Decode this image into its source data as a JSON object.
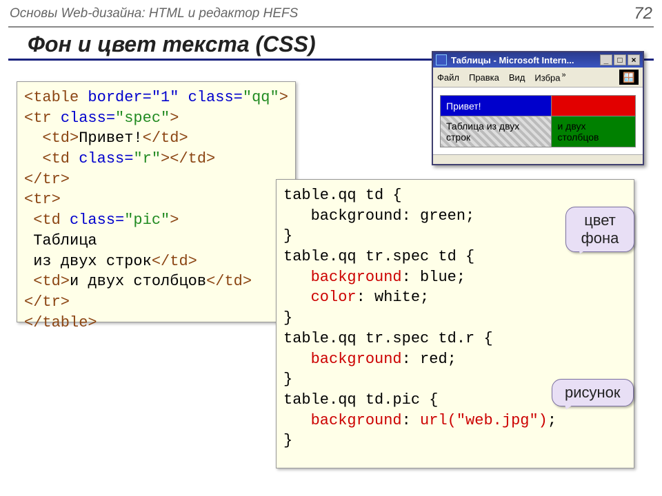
{
  "header": {
    "breadcrumb": "Основы Web-дизайна: HTML и редактор HEFS",
    "page": "72"
  },
  "title": "Фон и цвет текста (CSS)",
  "html_code": {
    "l1a": "<table ",
    "l1b": "border=\"1\"",
    "l1c": " class=",
    "l1d": "\"qq\"",
    "l1e": ">",
    "l2a": "<tr ",
    "l2b": "class=",
    "l2c": "\"spec\"",
    "l2d": ">",
    "l3a": "  <td>",
    "l3b": "Привет!",
    "l3c": "</td>",
    "l4a": "  <td ",
    "l4b": "class=",
    "l4c": "\"r\"",
    "l4d": "></td>",
    "l5": "</tr>",
    "l6": "<tr>",
    "l7a": " <td ",
    "l7b": "class=",
    "l7c": "\"pic\"",
    "l7d": ">",
    "l8": " Таблица",
    "l9a": " из двух строк",
    "l9b": "</td>",
    "l10a": " <td>",
    "l10b": "и двух столбцов",
    "l10c": "</td>",
    "l11": "</tr>",
    "l12": "</table>"
  },
  "css_code": {
    "l1": "table.qq td {",
    "l2a": "   background",
    "l2b": ": green;",
    "l3": "}",
    "l4": "table.qq tr.spec td {",
    "l5a": "   background",
    "l5b": ": blue;",
    "l6a": "   color",
    "l6b": ": white;",
    "l7": "}",
    "l8": "table.qq tr.spec td.r {",
    "l9a": "   background",
    "l9b": ": red;",
    "l10": "}",
    "l11": "table.qq td.pic {",
    "l12a": "   background",
    "l12b": ": ",
    "l12c": "url(\"web.jpg\")",
    "l12d": ";",
    "l13": "}"
  },
  "callouts": {
    "bg": "цвет фона",
    "pic": "рисунок"
  },
  "browser": {
    "title": "Таблицы - Microsoft Intern...",
    "menu": {
      "file": "Файл",
      "edit": "Правка",
      "view": "Вид",
      "fav": "Избра",
      "chev": "»"
    },
    "btn": {
      "min": "_",
      "max": "□",
      "close": "×"
    },
    "cells": {
      "hello": "Привет!",
      "rows": "Таблица из двух строк",
      "cols": "и двух столбцов"
    }
  }
}
